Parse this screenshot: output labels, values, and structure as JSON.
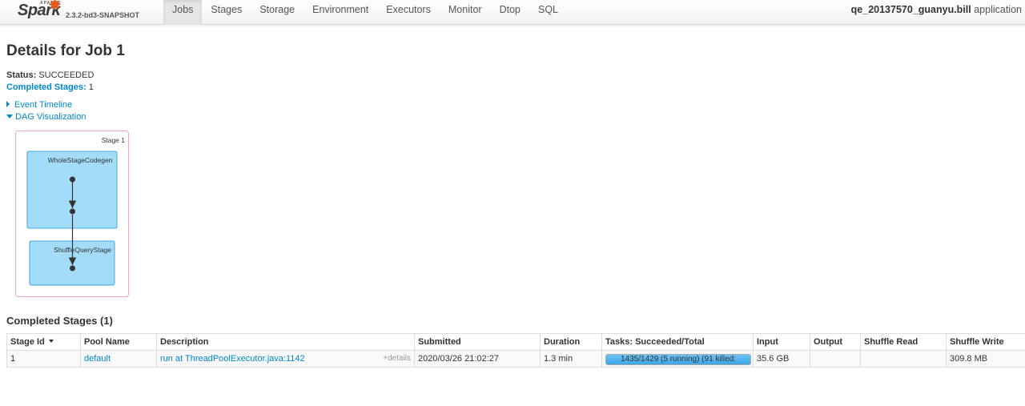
{
  "brand": {
    "apache": "APACHE",
    "name": "Spark",
    "version": "2.3.2-bd3-SNAPSHOT"
  },
  "nav": {
    "tabs": [
      "Jobs",
      "Stages",
      "Storage",
      "Environment",
      "Executors",
      "Monitor",
      "Dtop",
      "SQL"
    ],
    "active": "Jobs",
    "app_user": "qe_20137570_guanyu.bill",
    "app_suffix": " application"
  },
  "page": {
    "title": "Details for Job 1",
    "status_label": "Status:",
    "status_value": "SUCCEEDED",
    "completed_label": "Completed Stages:",
    "completed_value": "1",
    "event_timeline": "Event Timeline",
    "dag_visualization": "DAG Visualization"
  },
  "dag": {
    "stage_label": "Stage 1",
    "clusters": [
      "WholeStageCodegen",
      "ShuffleQueryStage"
    ],
    "colors": {
      "stage_border": "#f4a6b8",
      "cluster_fill": "#a3dcf8",
      "cluster_border": "#3ea6e0",
      "node": "#333333"
    }
  },
  "completed_stages": {
    "title": "Completed Stages (1)",
    "headers": [
      "Stage Id",
      "Pool Name",
      "Description",
      "Submitted",
      "Duration",
      "Tasks: Succeeded/Total",
      "Input",
      "Output",
      "Shuffle Read",
      "Shuffle Write"
    ],
    "sort_column": "Stage Id",
    "rows": [
      {
        "stage_id": "1",
        "pool_name": "default",
        "description": "run at ThreadPoolExecutor.java:1142",
        "details": "+details",
        "submitted": "2020/03/26 21:02:27",
        "duration": "1.3 min",
        "tasks_text": "1435/1429 (5 running) (91 killed:",
        "tasks_progress_percent": 100,
        "input": "35.6 GB",
        "output": "",
        "shuffle_read": "",
        "shuffle_write": "309.8 MB"
      }
    ]
  }
}
